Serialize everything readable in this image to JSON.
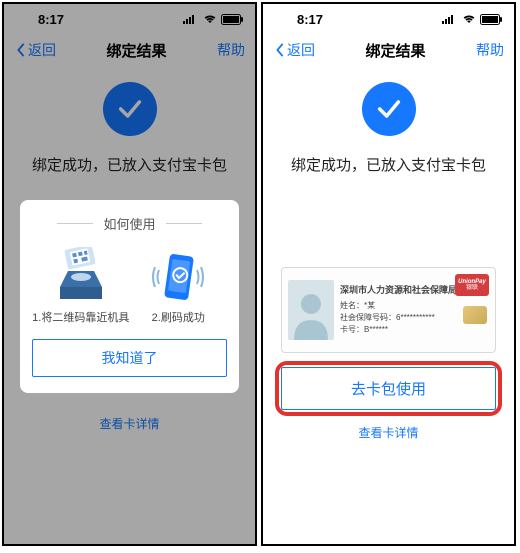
{
  "status": {
    "time": "8:17"
  },
  "nav": {
    "back": "返回",
    "title": "绑定结果",
    "help": "帮助"
  },
  "success_msg": "绑定成功，已放入支付宝卡包",
  "modal": {
    "title": "如何使用",
    "step1": "1.将二维码靠近机具",
    "step2": "2.刷码成功",
    "ok": "我知道了"
  },
  "detail_link": "查看卡详情",
  "right": {
    "card": {
      "issuer": "深圳市人力资源和社会保障局",
      "name_label": "姓名：",
      "name_value": "*某",
      "sid_label": "社会保障号码：",
      "sid_value": "6***********",
      "cid_label": "卡号：",
      "cid_value": "B******",
      "unionpay_en": "UnionPay",
      "unionpay_cn": "银联"
    },
    "main_btn": "去卡包使用"
  }
}
